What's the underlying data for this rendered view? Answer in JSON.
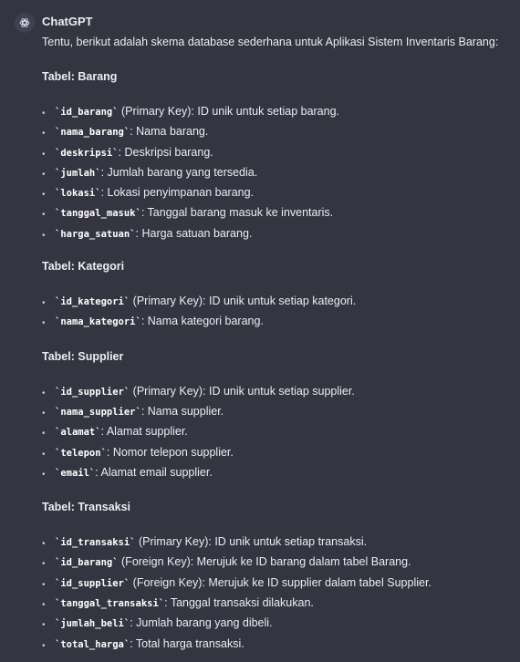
{
  "message": {
    "avatar_icon": "openai-logo-icon",
    "sender": "ChatGPT",
    "intro": "Tentu, berikut adalah skema database sederhana untuk Aplikasi Sistem Inventaris Barang:"
  },
  "tables": [
    {
      "heading": "Tabel: Barang",
      "fields": [
        {
          "code": "`id_barang`",
          "text": " (Primary Key): ID unik untuk setiap barang."
        },
        {
          "code": "`nama_barang`",
          "text": ": Nama barang."
        },
        {
          "code": "`deskripsi`",
          "text": ": Deskripsi barang."
        },
        {
          "code": "`jumlah`",
          "text": ": Jumlah barang yang tersedia."
        },
        {
          "code": "`lokasi`",
          "text": ": Lokasi penyimpanan barang."
        },
        {
          "code": "`tanggal_masuk`",
          "text": ": Tanggal barang masuk ke inventaris."
        },
        {
          "code": "`harga_satuan`",
          "text": ": Harga satuan barang."
        }
      ]
    },
    {
      "heading": "Tabel: Kategori",
      "fields": [
        {
          "code": "`id_kategori`",
          "text": " (Primary Key): ID unik untuk setiap kategori."
        },
        {
          "code": "`nama_kategori`",
          "text": ": Nama kategori barang."
        }
      ]
    },
    {
      "heading": "Tabel: Supplier",
      "fields": [
        {
          "code": "`id_supplier`",
          "text": " (Primary Key): ID unik untuk setiap supplier."
        },
        {
          "code": "`nama_supplier`",
          "text": ": Nama supplier."
        },
        {
          "code": "`alamat`",
          "text": ": Alamat supplier."
        },
        {
          "code": "`telepon`",
          "text": ": Nomor telepon supplier."
        },
        {
          "code": "`email`",
          "text": ": Alamat email supplier."
        }
      ]
    },
    {
      "heading": "Tabel: Transaksi",
      "fields": [
        {
          "code": "`id_transaksi`",
          "text": " (Primary Key): ID unik untuk setiap transaksi."
        },
        {
          "code": "`id_barang`",
          "text": " (Foreign Key): Merujuk ke ID barang dalam tabel Barang."
        },
        {
          "code": "`id_supplier`",
          "text": " (Foreign Key): Merujuk ke ID supplier dalam tabel Supplier."
        },
        {
          "code": "`tanggal_transaksi`",
          "text": ": Tanggal transaksi dilakukan."
        },
        {
          "code": "`jumlah_beli`",
          "text": ": Jumlah barang yang dibeli."
        },
        {
          "code": "`total_harga`",
          "text": ": Total harga transaksi."
        }
      ]
    }
  ]
}
